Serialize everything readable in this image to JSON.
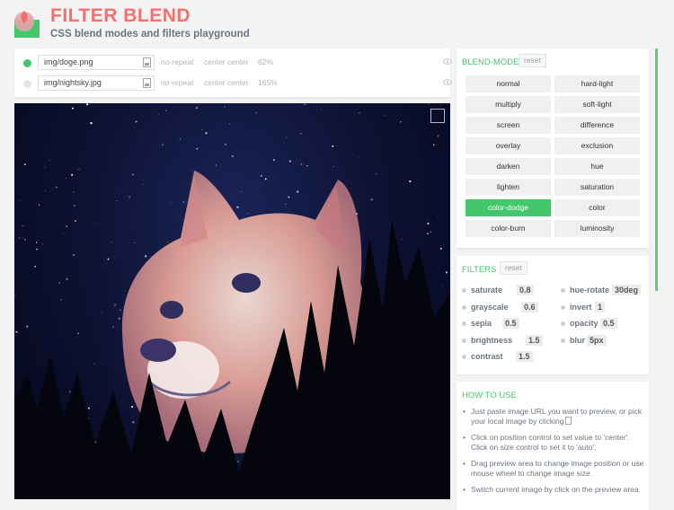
{
  "header": {
    "title": "FILTER BLEND",
    "subtitle": "CSS blend modes and filters playground",
    "logo_icon": "filter-blend-logo"
  },
  "layers": [
    {
      "name": "img/doge.png",
      "repeat": "no-repeat",
      "position": "center center",
      "size": "62%",
      "active": true
    },
    {
      "name": "img/nightsky.jpg",
      "repeat": "no-repeat",
      "position": "center center",
      "size": "165%",
      "active": false
    }
  ],
  "blend_mode": {
    "title": "BLEND-MODE",
    "reset_label": "reset",
    "modes": [
      "normal",
      "hard-light",
      "multiply",
      "soft-light",
      "screen",
      "difference",
      "overlay",
      "exclusion",
      "darken",
      "hue",
      "lighten",
      "saturation",
      "color-dodge",
      "color",
      "color-burn",
      "luminosity"
    ],
    "selected": "color-dodge"
  },
  "filters": {
    "title": "FILTERS",
    "reset_label": "reset",
    "items": [
      {
        "name": "saturate",
        "value": "0.8"
      },
      {
        "name": "hue-rotate",
        "value": "30deg"
      },
      {
        "name": "grayscale",
        "value": "0.6"
      },
      {
        "name": "invert",
        "value": "1"
      },
      {
        "name": "sepia",
        "value": "0.5"
      },
      {
        "name": "opacity",
        "value": "0.5"
      },
      {
        "name": "brightness",
        "value": "1.5"
      },
      {
        "name": "blur",
        "value": "5px"
      },
      {
        "name": "contrast",
        "value": "1.5"
      }
    ]
  },
  "how_to_use": {
    "title": "HOW TO USE",
    "items": [
      "Just paste image URL you want to preview, or pick your local image by clicking",
      "Click on position control to set value to 'center'. Click on size control to set it to 'auto'.",
      "Drag preview area to change image position or use mouse wheel to change image size.",
      "Switch current image by click on the preview area."
    ]
  },
  "colors": {
    "accent": "#43c76a",
    "title": "#f0716f",
    "text": "#6b7480"
  }
}
